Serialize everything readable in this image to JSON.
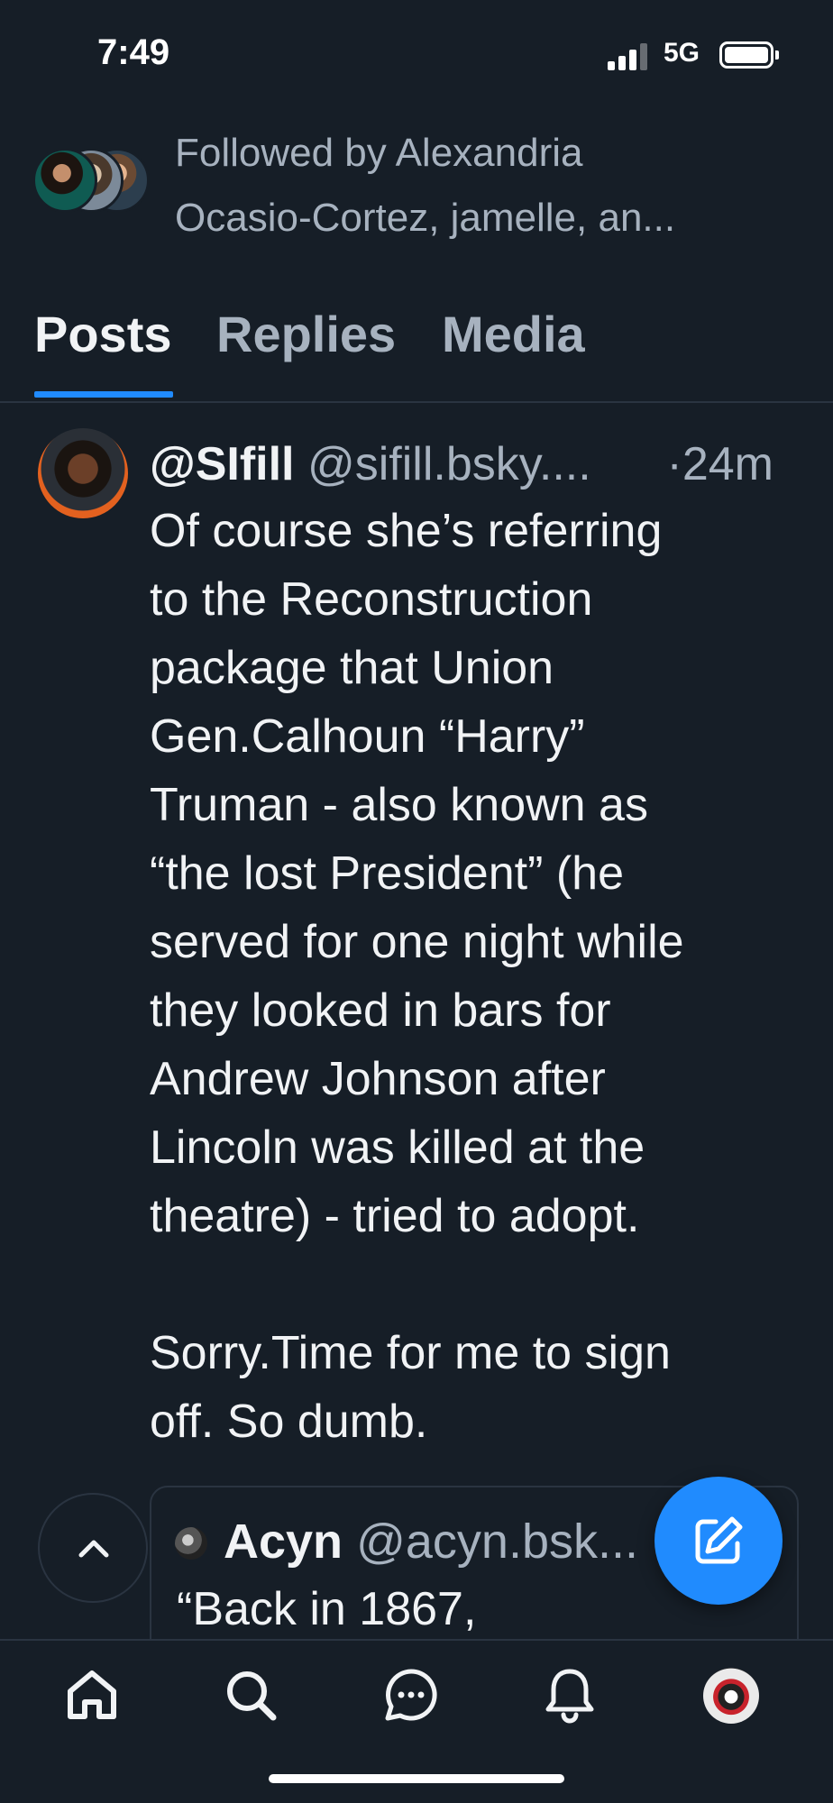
{
  "status_bar": {
    "time": "7:49",
    "network": "5G"
  },
  "followed_by": {
    "line1": "Followed by Alexandria",
    "line2": "Ocasio-Cortez, jamelle, an..."
  },
  "tabs": [
    {
      "label": "Posts",
      "active": true
    },
    {
      "label": "Replies",
      "active": false
    },
    {
      "label": "Media",
      "active": false
    }
  ],
  "post": {
    "display_name": "@SIfill",
    "handle": "@sifill.bsky....",
    "time": "·24m",
    "body": "Of course she’s referring\nto the Reconstruction\npackage that Union\nGen.Calhoun “Harry”\nTruman - also known as\n“the lost President” (he\nserved for one night while\nthey looked in bars for\nAndrew Johnson after\nLincoln was killed at the\ntheatre) - tried to adopt.\n\nSorry.Time for me to sign\noff. So dumb.",
    "quote": {
      "display_name": "Acyn",
      "handle": "@acyn.bsk...",
      "text": "“Back in 1867,"
    }
  },
  "icons": {
    "scroll_top": "chevron-up-icon",
    "compose": "compose-icon",
    "nav": [
      "home-icon",
      "search-icon",
      "chat-icon",
      "bell-icon",
      "profile-avatar"
    ]
  },
  "colors": {
    "background": "#161e27",
    "accent": "#208bfe",
    "muted_text": "#a7b2bf",
    "text": "#f1f3f5",
    "border": "#2a3441"
  }
}
